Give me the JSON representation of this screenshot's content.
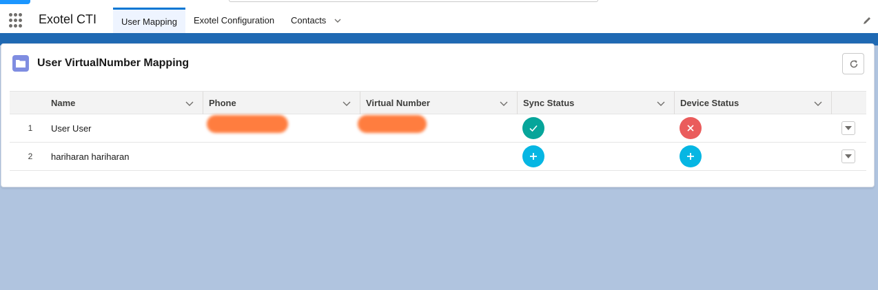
{
  "nav": {
    "app_title": "Exotel CTI",
    "tabs": [
      {
        "label": "User Mapping",
        "active": true
      },
      {
        "label": "Exotel Configuration",
        "active": false
      },
      {
        "label": "Contacts",
        "active": false,
        "has_menu": true
      }
    ]
  },
  "card": {
    "title": "User VirtualNumber Mapping",
    "icon": "folder-icon",
    "refresh_icon": "refresh-icon"
  },
  "table": {
    "columns": [
      "Name",
      "Phone",
      "Virtual Number",
      "Sync Status",
      "Device Status"
    ],
    "rows": [
      {
        "num": "1",
        "name": "User User",
        "phone_redacted": true,
        "virtual_redacted": true,
        "sync_status": "check-icon",
        "device_status": "close-icon"
      },
      {
        "num": "2",
        "name": "hariharan hariharan",
        "phone_redacted": false,
        "virtual_redacted": false,
        "sync_status": "add-icon",
        "device_status": "add-icon"
      }
    ]
  },
  "colors": {
    "brand_blue": "#0176d3",
    "band_blue": "#1f69b3",
    "background": "#b0c4df",
    "success": "#06a59a",
    "error": "#ea5c5c",
    "add": "#06b6e3",
    "redaction": "#ff7d3f"
  }
}
